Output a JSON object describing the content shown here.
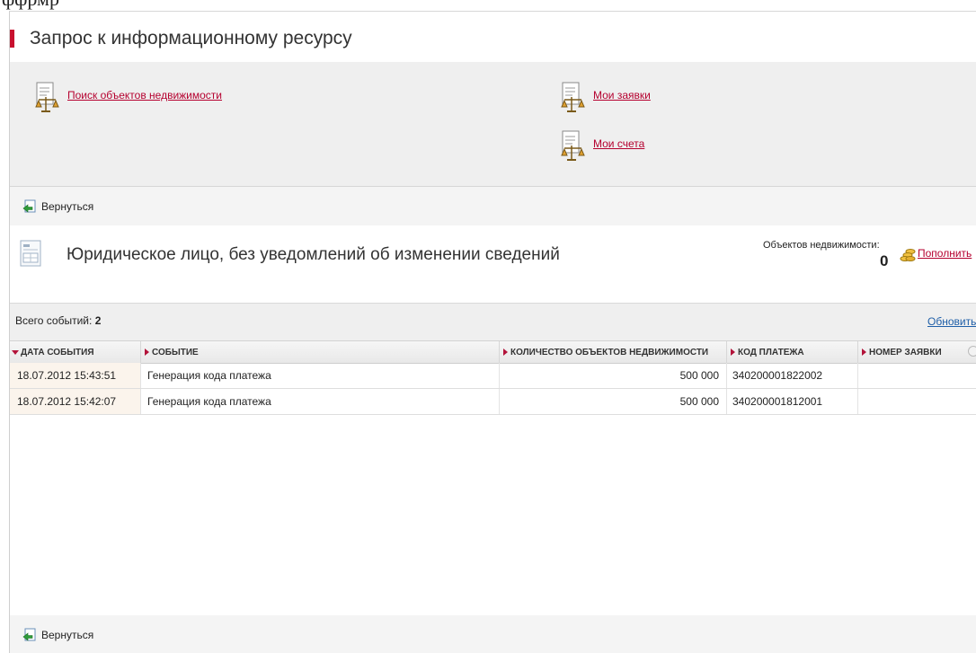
{
  "colors": {
    "accent": "#c8102e",
    "link": "#b5002f",
    "blue_link": "#1f5fa8",
    "sort_marker": "#b3133a"
  },
  "top_fragment": "ффрмр",
  "header": {
    "title": "Запрос к информационному ресурсу"
  },
  "links": {
    "search": "Поиск объектов недвижимости",
    "my_requests": "Мои заявки",
    "my_accounts": "Мои счета"
  },
  "back_label": "Вернуться",
  "info": {
    "title": "Юридическое лицо, без уведомлений об изменении сведений",
    "objects_label": "Объектов недвижимости:",
    "objects_count": "0",
    "topup_label": "Пополнить"
  },
  "summary": {
    "events_label": "Всего событий:",
    "events_count": "2",
    "refresh_label": "Обновить"
  },
  "table": {
    "columns": [
      "ДАТА СОБЫТИЯ",
      "СОБЫТИЕ",
      "КОЛИЧЕСТВО ОБЪЕКТОВ НЕДВИЖИМОСТИ",
      "КОД ПЛАТЕЖА",
      "НОМЕР ЗАЯВКИ"
    ],
    "rows": [
      {
        "date": "18.07.2012 15:43:51",
        "event": "Генерация кода платежа",
        "quantity": "500 000",
        "payment_code": "340200001822002",
        "request_no": ""
      },
      {
        "date": "18.07.2012 15:42:07",
        "event": "Генерация кода платежа",
        "quantity": "500 000",
        "payment_code": "340200001812001",
        "request_no": ""
      }
    ]
  },
  "icons": {
    "document": "document-scales-icon",
    "back": "back-arrow-icon",
    "card": "document-card-icon",
    "coins": "coins-icon"
  }
}
